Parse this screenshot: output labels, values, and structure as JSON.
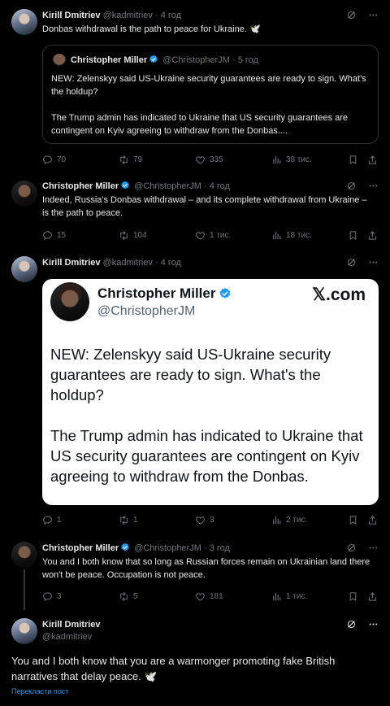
{
  "tweets": [
    {
      "name": "Kirill Dmitriev",
      "handle": "@kadmitriev",
      "dot": "·",
      "time": "4 год",
      "text": "Donbas withdrawal is the path to peace for Ukraine. 🕊️",
      "quote": {
        "name": "Christopher Miller",
        "handle": "@ChristopherJM",
        "dot": "·",
        "time": "5 год",
        "text1": "NEW: Zelenskyy said US-Ukraine security guarantees are ready to sign. What's the holdup?",
        "text2": "The Trump admin has indicated to Ukraine that US security guarantees are contingent on Kyiv agreeing to withdraw from the Donbas...."
      },
      "stats": {
        "replies": "70",
        "reposts": "79",
        "likes": "335",
        "views": "38 тис."
      }
    },
    {
      "name": "Christopher Miller",
      "handle": "@ChristopherJM",
      "dot": "·",
      "time": "4 год",
      "text": "Indeed, Russia's Donbas withdrawal – and its complete withdrawal from Ukraine – is the path to peace.",
      "stats": {
        "replies": "15",
        "reposts": "104",
        "likes": "1 тис.",
        "views": "18 тис."
      }
    },
    {
      "name": "Kirill Dmitriev",
      "handle": "@kadmitriev",
      "dot": "·",
      "time": "4 год",
      "card": {
        "name": "Christopher Miller",
        "handle": "@ChristopherJM",
        "logo": "𝕏.com",
        "text1": "NEW: Zelenskyy said US-Ukraine security guarantees are ready to sign. What's the holdup?",
        "text2": "The Trump admin has indicated to Ukraine that US security guarantees are contingent on Kyiv agreeing to withdraw from the Donbas."
      },
      "stats": {
        "replies": "1",
        "reposts": "1",
        "likes": "3",
        "views": "2 тис."
      }
    },
    {
      "name": "Christopher Miller",
      "handle": "@ChristopherJM",
      "dot": "·",
      "time": "3 год",
      "text": "You and I both know that so long as Russian forces remain on Ukrainian land there won't be peace. Occupation is not peace.",
      "stats": {
        "replies": "3",
        "reposts": "5",
        "likes": "181",
        "views": "1 тис."
      }
    },
    {
      "name": "Kirill Dmitriev",
      "handle": "@kadmitriev",
      "text": "You and I both know that you are a warmonger promoting fake British narratives that delay peace. 🕊️",
      "translate": "Перекласти пост"
    }
  ],
  "icons": {
    "reply": "reply-icon",
    "repost": "repost-icon",
    "like": "heart-icon",
    "views": "views-icon",
    "bookmark": "bookmark-icon",
    "share": "share-icon",
    "grok": "grok-icon",
    "more": "more-icon",
    "verified": "verified-badge-icon"
  },
  "colors": {
    "background": "#000000",
    "text": "#e7e9ea",
    "muted": "#71767b",
    "accent": "#1d9bf0",
    "border": "#2f3336"
  }
}
